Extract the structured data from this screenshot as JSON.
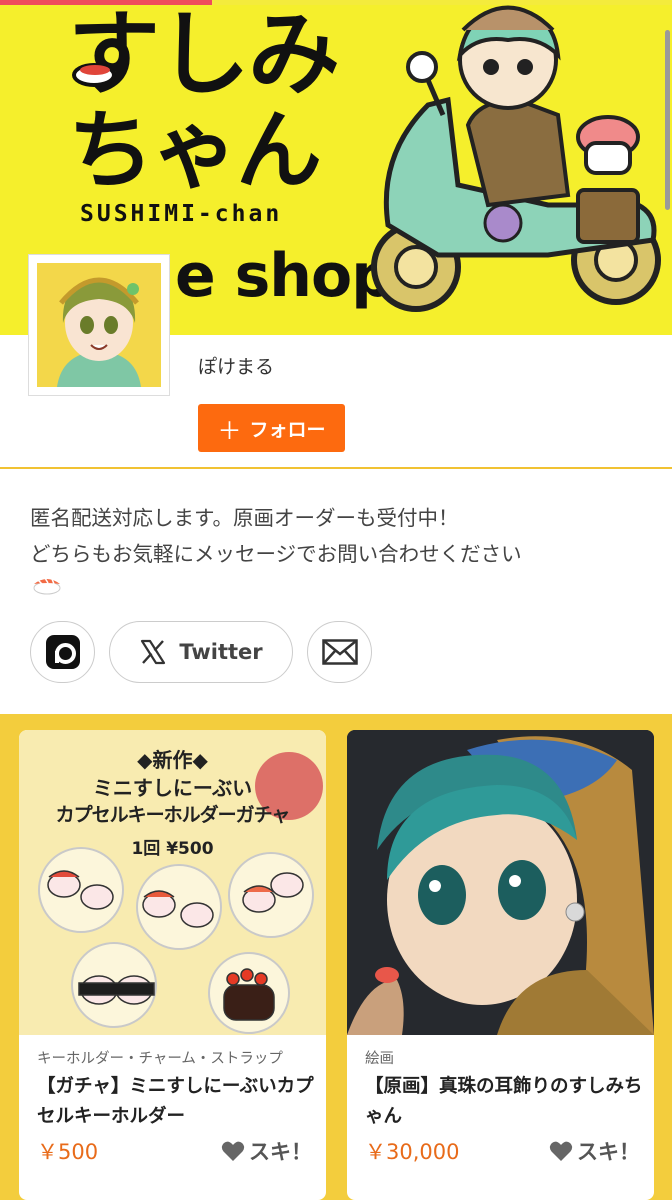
{
  "banner": {
    "logo_line1": "すしみ",
    "logo_line2": "ちゃん",
    "logo_sub": "SUSHIMI-chan",
    "shop_text": "e shop"
  },
  "profile": {
    "name": "ぽけまる",
    "follow_label": "フォロー"
  },
  "description": {
    "line1": "匿名配送対応します。原画オーダーも受付中！",
    "line2": "どちらもお気軽にメッセージでお問い合わせください"
  },
  "social": {
    "twitter_label": "Twitter"
  },
  "items": [
    {
      "image_text": {
        "line1": "◆新作◆",
        "line2": "ミニすしにーぶい",
        "line3": "カプセルキーホルダーガチャ",
        "line4": "1回 ¥500"
      },
      "category": "キーホルダー・チャーム・ストラップ",
      "title": "【ガチャ】ミニすしにーぶいカプセルキーホルダー",
      "price": "￥500",
      "like_label": "スキ！"
    },
    {
      "category": "絵画",
      "title": "【原画】真珠の耳飾りのすしみちゃん",
      "price": "￥30,000",
      "like_label": "スキ！"
    }
  ],
  "colors": {
    "banner_bg": "#f5ef2c",
    "accent": "#fd6a0f",
    "grid_bg": "#f3cd3d",
    "price": "#e86b1a"
  },
  "icons": [
    "pixiv-icon",
    "x-icon",
    "mail-icon",
    "plus-icon",
    "heart-icon",
    "sushi-emoji"
  ]
}
